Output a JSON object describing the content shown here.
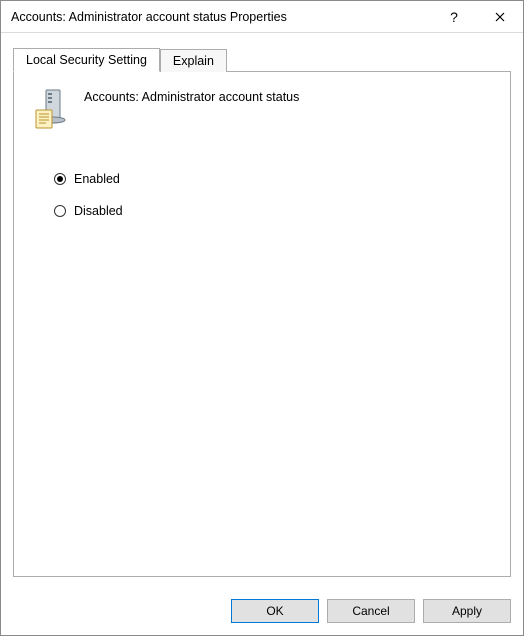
{
  "window": {
    "title": "Accounts: Administrator account status Properties"
  },
  "tabs": {
    "local_security": "Local Security Setting",
    "explain": "Explain"
  },
  "policy": {
    "name": "Accounts: Administrator account status"
  },
  "options": {
    "enabled_label": "Enabled",
    "disabled_label": "Disabled",
    "selected": "enabled"
  },
  "buttons": {
    "ok": "OK",
    "cancel": "Cancel",
    "apply": "Apply"
  }
}
